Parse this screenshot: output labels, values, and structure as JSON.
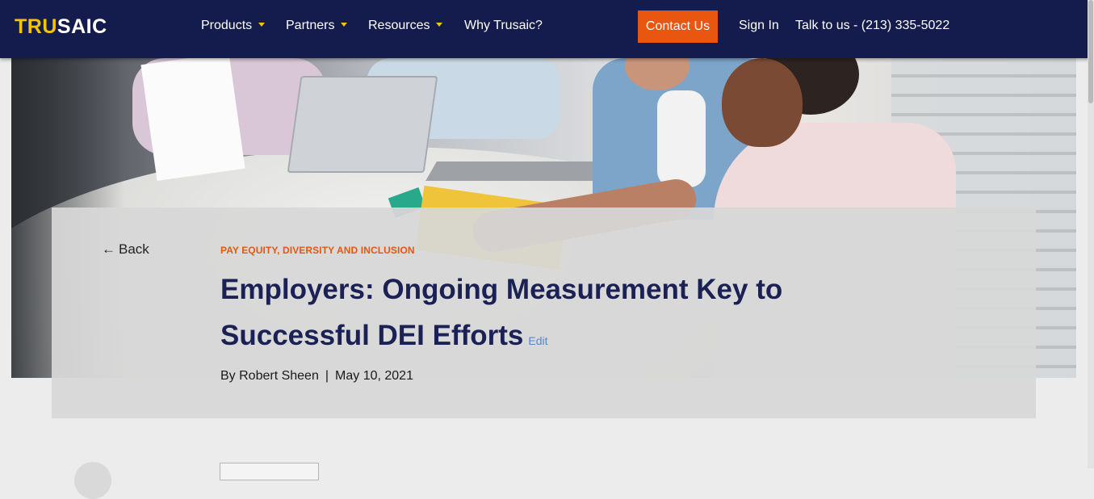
{
  "header": {
    "logo_left": "TRU",
    "logo_right": "SAIC",
    "nav": [
      {
        "label": "Products",
        "has_menu": true
      },
      {
        "label": "Partners",
        "has_menu": true
      },
      {
        "label": "Resources",
        "has_menu": true
      },
      {
        "label": "Why Trusaic?",
        "has_menu": false
      }
    ],
    "contact_label": "Contact Us",
    "signin_label": "Sign In",
    "talk_label": "Talk to us - (213) 335-5022"
  },
  "colors": {
    "navy": "#141b4d",
    "accent_orange": "#e8560f",
    "logo_yellow": "#f5c400",
    "title_navy": "#1b2155"
  },
  "article": {
    "back_label": "Back",
    "category": "PAY EQUITY, DIVERSITY AND INCLUSION",
    "title": "Employers: Ongoing Measurement Key to Successful DEI Efforts",
    "edit_label": "Edit",
    "author": "By Robert Sheen",
    "separator": "|",
    "date": "May 10, 2021"
  },
  "icons": {
    "back": "arrow-left-icon",
    "menu_caret": "caret-down-icon"
  }
}
